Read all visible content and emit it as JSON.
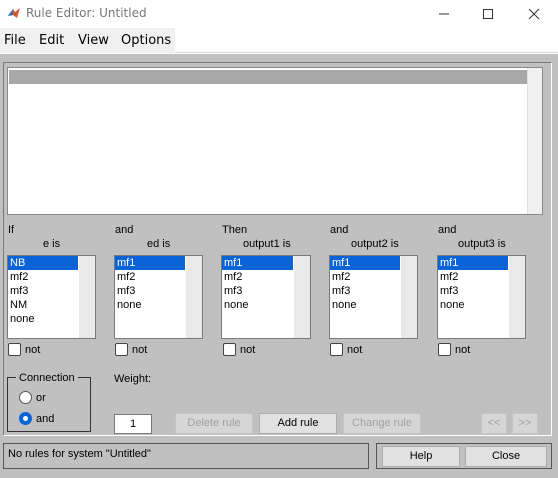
{
  "window": {
    "title": "Rule Editor: Untitled"
  },
  "menu": [
    "File",
    "Edit",
    "View",
    "Options"
  ],
  "columns": [
    {
      "prefix": "If",
      "name": "e is",
      "options": [
        "NB",
        "mf2",
        "mf3",
        "NM",
        "none"
      ],
      "selected": 0,
      "not_label": "not"
    },
    {
      "prefix": "and",
      "name": "ed is",
      "options": [
        "mf1",
        "mf2",
        "mf3",
        "none"
      ],
      "selected": 0,
      "not_label": "not"
    },
    {
      "prefix": "Then",
      "name": "output1 is",
      "options": [
        "mf1",
        "mf2",
        "mf3",
        "none"
      ],
      "selected": 0,
      "not_label": "not"
    },
    {
      "prefix": "and",
      "name": "output2 is",
      "options": [
        "mf1",
        "mf2",
        "mf3",
        "none"
      ],
      "selected": 0,
      "not_label": "not"
    },
    {
      "prefix": "and",
      "name": "output3 is",
      "options": [
        "mf1",
        "mf2",
        "mf3",
        "none"
      ],
      "selected": 0,
      "not_label": "not"
    }
  ],
  "connection": {
    "title": "Connection",
    "or_label": "or",
    "and_label": "and",
    "selected": "and"
  },
  "weight": {
    "label": "Weight:",
    "value": "1"
  },
  "buttons": {
    "delete_rule": "Delete rule",
    "add_rule": "Add rule",
    "change_rule": "Change rule",
    "prev": "<<",
    "next": ">>",
    "help": "Help",
    "close": "Close"
  },
  "status": "No rules for system \"Untitled\"",
  "icons": {
    "app": "matlab-icon",
    "minimize": "minimize-icon",
    "maximize": "maximize-icon",
    "close": "close-icon"
  },
  "colors": {
    "selection": "#0a64d7",
    "panel": "#c0c0c0"
  }
}
